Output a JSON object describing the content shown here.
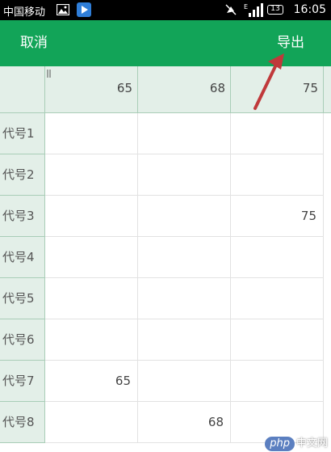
{
  "status_bar": {
    "carrier": "中国移动",
    "network": "E",
    "battery": "13",
    "time": "16:05"
  },
  "toolbar": {
    "cancel_label": "取消",
    "export_label": "导出"
  },
  "table": {
    "column_headers": [
      "65",
      "68",
      "75"
    ],
    "rows": [
      {
        "label": "代号1",
        "cells": [
          "",
          "",
          ""
        ]
      },
      {
        "label": "代号2",
        "cells": [
          "",
          "",
          ""
        ]
      },
      {
        "label": "代号3",
        "cells": [
          "",
          "",
          "75"
        ]
      },
      {
        "label": "代号4",
        "cells": [
          "",
          "",
          ""
        ]
      },
      {
        "label": "代号5",
        "cells": [
          "",
          "",
          ""
        ]
      },
      {
        "label": "代号6",
        "cells": [
          "",
          "",
          ""
        ]
      },
      {
        "label": "代号7",
        "cells": [
          "65",
          "",
          ""
        ]
      },
      {
        "label": "代号8",
        "cells": [
          "",
          "68",
          ""
        ]
      }
    ]
  },
  "watermark": {
    "logo_text": "php",
    "site_text": "中文网"
  },
  "colors": {
    "toolbar": "#12a458",
    "header_bg": "#e3efe8",
    "arrow": "#c0393b"
  }
}
